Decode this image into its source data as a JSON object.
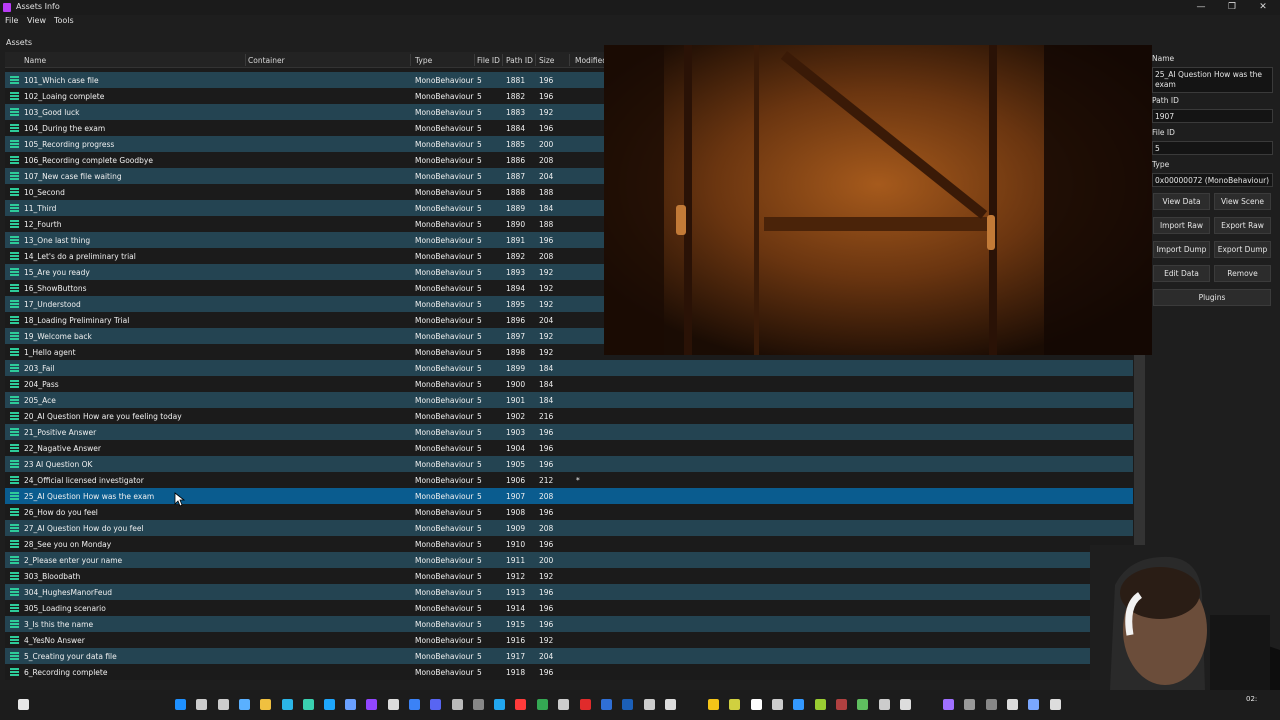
{
  "window": {
    "title": "Assets Info",
    "minimize": "—",
    "maximize": "❐",
    "close": "✕"
  },
  "menu": [
    "File",
    "View",
    "Tools"
  ],
  "assets_label": "Assets",
  "columns": [
    "Name",
    "Container",
    "Type",
    "File ID",
    "Path ID",
    "Size",
    "Modified"
  ],
  "rows": [
    {
      "name": "101_Which case file",
      "type": "MonoBehaviour",
      "file_id": "5",
      "path_id": "1881",
      "size": "196",
      "modified": ""
    },
    {
      "name": "102_Loaing complete",
      "type": "MonoBehaviour",
      "file_id": "5",
      "path_id": "1882",
      "size": "196",
      "modified": ""
    },
    {
      "name": "103_Good luck",
      "type": "MonoBehaviour",
      "file_id": "5",
      "path_id": "1883",
      "size": "192",
      "modified": ""
    },
    {
      "name": "104_During the exam",
      "type": "MonoBehaviour",
      "file_id": "5",
      "path_id": "1884",
      "size": "196",
      "modified": ""
    },
    {
      "name": "105_Recording progress",
      "type": "MonoBehaviour",
      "file_id": "5",
      "path_id": "1885",
      "size": "200",
      "modified": ""
    },
    {
      "name": "106_Recording complete Goodbye",
      "type": "MonoBehaviour",
      "file_id": "5",
      "path_id": "1886",
      "size": "208",
      "modified": ""
    },
    {
      "name": "107_New case file waiting",
      "type": "MonoBehaviour",
      "file_id": "5",
      "path_id": "1887",
      "size": "204",
      "modified": ""
    },
    {
      "name": "10_Second",
      "type": "MonoBehaviour",
      "file_id": "5",
      "path_id": "1888",
      "size": "188",
      "modified": ""
    },
    {
      "name": "11_Third",
      "type": "MonoBehaviour",
      "file_id": "5",
      "path_id": "1889",
      "size": "184",
      "modified": ""
    },
    {
      "name": "12_Fourth",
      "type": "MonoBehaviour",
      "file_id": "5",
      "path_id": "1890",
      "size": "188",
      "modified": ""
    },
    {
      "name": "13_One last thing",
      "type": "MonoBehaviour",
      "file_id": "5",
      "path_id": "1891",
      "size": "196",
      "modified": ""
    },
    {
      "name": "14_Let's do a preliminary trial",
      "type": "MonoBehaviour",
      "file_id": "5",
      "path_id": "1892",
      "size": "208",
      "modified": ""
    },
    {
      "name": "15_Are you ready",
      "type": "MonoBehaviour",
      "file_id": "5",
      "path_id": "1893",
      "size": "192",
      "modified": ""
    },
    {
      "name": "16_ShowButtons",
      "type": "MonoBehaviour",
      "file_id": "5",
      "path_id": "1894",
      "size": "192",
      "modified": ""
    },
    {
      "name": "17_Understood",
      "type": "MonoBehaviour",
      "file_id": "5",
      "path_id": "1895",
      "size": "192",
      "modified": ""
    },
    {
      "name": "18_Loading Preliminary Trial",
      "type": "MonoBehaviour",
      "file_id": "5",
      "path_id": "1896",
      "size": "204",
      "modified": ""
    },
    {
      "name": "19_Welcome back",
      "type": "MonoBehaviour",
      "file_id": "5",
      "path_id": "1897",
      "size": "192",
      "modified": ""
    },
    {
      "name": "1_Hello agent",
      "type": "MonoBehaviour",
      "file_id": "5",
      "path_id": "1898",
      "size": "192",
      "modified": ""
    },
    {
      "name": "203_Fail",
      "type": "MonoBehaviour",
      "file_id": "5",
      "path_id": "1899",
      "size": "184",
      "modified": ""
    },
    {
      "name": "204_Pass",
      "type": "MonoBehaviour",
      "file_id": "5",
      "path_id": "1900",
      "size": "184",
      "modified": ""
    },
    {
      "name": "205_Ace",
      "type": "MonoBehaviour",
      "file_id": "5",
      "path_id": "1901",
      "size": "184",
      "modified": ""
    },
    {
      "name": "20_AI Question How are you feeling today",
      "type": "MonoBehaviour",
      "file_id": "5",
      "path_id": "1902",
      "size": "216",
      "modified": ""
    },
    {
      "name": "21_Positive Answer",
      "type": "MonoBehaviour",
      "file_id": "5",
      "path_id": "1903",
      "size": "196",
      "modified": ""
    },
    {
      "name": "22_Nagative Answer",
      "type": "MonoBehaviour",
      "file_id": "5",
      "path_id": "1904",
      "size": "196",
      "modified": ""
    },
    {
      "name": "23 AI Question OK",
      "type": "MonoBehaviour",
      "file_id": "5",
      "path_id": "1905",
      "size": "196",
      "modified": ""
    },
    {
      "name": "24_Official licensed investigator",
      "type": "MonoBehaviour",
      "file_id": "5",
      "path_id": "1906",
      "size": "212",
      "modified": "*"
    },
    {
      "name": "25_AI Question How was the exam",
      "type": "MonoBehaviour",
      "file_id": "5",
      "path_id": "1907",
      "size": "208",
      "modified": ""
    },
    {
      "name": "26_How do you feel",
      "type": "MonoBehaviour",
      "file_id": "5",
      "path_id": "1908",
      "size": "196",
      "modified": ""
    },
    {
      "name": "27_AI Question How do you feel",
      "type": "MonoBehaviour",
      "file_id": "5",
      "path_id": "1909",
      "size": "208",
      "modified": ""
    },
    {
      "name": "28_See you on Monday",
      "type": "MonoBehaviour",
      "file_id": "5",
      "path_id": "1910",
      "size": "196",
      "modified": ""
    },
    {
      "name": "2_Please enter your name",
      "type": "MonoBehaviour",
      "file_id": "5",
      "path_id": "1911",
      "size": "200",
      "modified": ""
    },
    {
      "name": "303_Bloodbath",
      "type": "MonoBehaviour",
      "file_id": "5",
      "path_id": "1912",
      "size": "192",
      "modified": ""
    },
    {
      "name": "304_HughesManorFeud",
      "type": "MonoBehaviour",
      "file_id": "5",
      "path_id": "1913",
      "size": "196",
      "modified": ""
    },
    {
      "name": "305_Loading scenario",
      "type": "MonoBehaviour",
      "file_id": "5",
      "path_id": "1914",
      "size": "196",
      "modified": ""
    },
    {
      "name": "3_Is this the name",
      "type": "MonoBehaviour",
      "file_id": "5",
      "path_id": "1915",
      "size": "196",
      "modified": ""
    },
    {
      "name": "4_YesNo Answer",
      "type": "MonoBehaviour",
      "file_id": "5",
      "path_id": "1916",
      "size": "192",
      "modified": ""
    },
    {
      "name": "5_Creating your data file",
      "type": "MonoBehaviour",
      "file_id": "5",
      "path_id": "1917",
      "size": "204",
      "modified": ""
    },
    {
      "name": "6_Recording complete",
      "type": "MonoBehaviour",
      "file_id": "5",
      "path_id": "1918",
      "size": "196",
      "modified": ""
    }
  ],
  "selected_row": 26,
  "details": {
    "name_label": "Name",
    "name_value": "25_AI Question How was the exam",
    "path_id_label": "Path ID",
    "path_id_value": "1907",
    "file_id_label": "File ID",
    "file_id_value": "5",
    "type_label": "Type",
    "type_value": "0x00000072 (MonoBehaviour)"
  },
  "buttons": {
    "view_data": "View Data",
    "view_scene": "View Scene",
    "import_raw": "Import Raw",
    "export_raw": "Export Raw",
    "import_dump": "Import Dump",
    "export_dump": "Export Dump",
    "edit_data": "Edit Data",
    "remove": "Remove",
    "plugins": "Plugins"
  },
  "taskbar": {
    "clock": "02:"
  },
  "colors": {
    "row_alt": "#244452",
    "row_selected": "#0a5c8f",
    "icon": "#2ecc9a",
    "background": "#1e1e1e"
  }
}
